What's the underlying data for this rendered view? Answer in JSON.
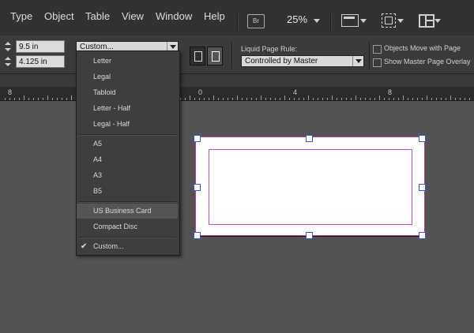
{
  "menu": [
    "Type",
    "Object",
    "Table",
    "View",
    "Window",
    "Help"
  ],
  "toolbar": {
    "bridge_label": "Br",
    "zoom": "25%"
  },
  "control": {
    "width_value": "9.5 in",
    "height_value": "4.125 in",
    "preset_value": "Custom...",
    "liquid_label": "Liquid Page Rule:",
    "liquid_value": "Controlled by Master",
    "objects_move_label": "Objects Move with Page",
    "show_master_label": "Show Master Page Overlay"
  },
  "ruler": {
    "labels": [
      "8",
      "0",
      "4",
      "8"
    ]
  },
  "dropdown": {
    "items": [
      "Letter",
      "Legal",
      "Tabloid",
      "Letter - Half",
      "Legal - Half",
      "A5",
      "A4",
      "A3",
      "B5",
      "US Business Card",
      "Compact Disc",
      "Custom..."
    ],
    "highlighted": "US Business Card",
    "checked": "Custom...",
    "check_glyph": "✔"
  },
  "colors": {
    "page_edge": "#c23b8a",
    "margin": "#c34dc8",
    "handle": "#3b56c8"
  }
}
